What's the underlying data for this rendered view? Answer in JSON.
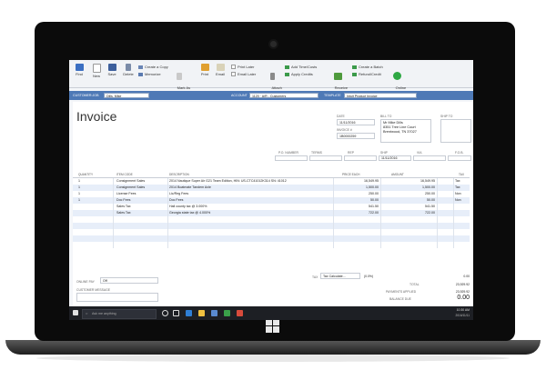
{
  "toolbar": {
    "find": "Find",
    "new": "New",
    "save": "Save",
    "delete": "Delete",
    "create_copy": "Create a Copy",
    "memorize": "Memorize",
    "mark_pending": "Mark As\nPending",
    "print": "Print",
    "email": "Email",
    "print_later": "Print Later",
    "email_later": "Email Later",
    "attach_file": "Attach\nFile",
    "add_time_costs": "Add Time/Costs",
    "apply_credits": "Apply Credits",
    "receive_payments": "Receive\nPayments",
    "create_batch": "Create a Batch",
    "refund_credit": "Refund/Credit",
    "online_pay": "Online\nPay"
  },
  "custbar": {
    "customer_job_label": "CUSTOMER:JOB",
    "customer_job_value": "Dills, Mike",
    "account_label": "ACCOUNT",
    "account_value": "1120 · A/R - Customers",
    "template_label": "TEMPLATE",
    "template_value": "Intuit Product Invoice"
  },
  "invoice": {
    "title": "Invoice",
    "date_label": "DATE",
    "date_value": "11/11/2016",
    "invoice_no_label": "INVOICE #",
    "invoice_no_value": "1B0000259",
    "bill_to_label": "BILL TO",
    "bill_to_lines": [
      "Mr Mike Dills",
      "8351 Tree Line Court",
      "Brentwood, TN 37027"
    ],
    "ship_to_label": "SHIP TO",
    "po_label": "P.O. NUMBER",
    "terms_label": "TERMS",
    "rep_label": "REP",
    "ship_label": "SHIP",
    "ship_value": "11/11/2016",
    "via_label": "VIA",
    "fob_label": "F.O.B."
  },
  "table": {
    "headers": [
      "QUANTITY",
      "ITEM CODE",
      "DESCRIPTION",
      "PRICE EACH",
      "AMOUNT",
      "TAX"
    ],
    "rows": [
      {
        "qty": "1",
        "item": "Consignment Sales",
        "desc": "2014 Nautique Super Air G21 Team Edition, HIN: US-CTC41012K314 SN: 41012",
        "price": "16,549.95",
        "amount": "16,549.95",
        "tax": "Tax"
      },
      {
        "qty": "1",
        "item": "Consignment Sales",
        "desc": "2014 Boatmate Tandem Axle",
        "price": "1,500.00",
        "amount": "1,500.00",
        "tax": "Tax"
      },
      {
        "qty": "1",
        "item": "License Fees",
        "desc": "Lic/Reg Fees",
        "price": "250.00",
        "amount": "250.00",
        "tax": "Non"
      },
      {
        "qty": "1",
        "item": "Doc Fees",
        "desc": "Doc Fees",
        "price": "50.00",
        "amount": "50.00",
        "tax": "Non"
      },
      {
        "qty": "",
        "item": "Sales Tax",
        "desc": "Hall county tax @ 3.000%",
        "price": "541.50",
        "amount": "541.50",
        "tax": ""
      },
      {
        "qty": "",
        "item": "Sales Tax",
        "desc": "Georgia state tax @ 4.000%",
        "price": "722.00",
        "amount": "722.00",
        "tax": ""
      },
      {
        "qty": "",
        "item": "",
        "desc": "",
        "price": "",
        "amount": "",
        "tax": ""
      },
      {
        "qty": "",
        "item": "",
        "desc": "",
        "price": "",
        "amount": "",
        "tax": ""
      },
      {
        "qty": "",
        "item": "",
        "desc": "",
        "price": "",
        "amount": "",
        "tax": ""
      },
      {
        "qty": "",
        "item": "",
        "desc": "",
        "price": "",
        "amount": "",
        "tax": ""
      },
      {
        "qty": "",
        "item": "",
        "desc": "",
        "price": "",
        "amount": "",
        "tax": ""
      }
    ]
  },
  "footer": {
    "online_pay_label": "ONLINE PAY",
    "online_pay_value": "Off",
    "customer_message_label": "CUSTOMER MESSAGE",
    "tax_label": "TAX",
    "tax_value": "Tax Calculate...",
    "tax_rate": "(0.0%)",
    "tax_amount": "0.00",
    "total_label": "TOTAL",
    "total_value": "23,929.92",
    "payments_label": "PAYMENTS APPLIED",
    "payments_value": "23,929.92",
    "balance_label": "BALANCE DUE",
    "balance_value": "0.00"
  },
  "taskbar": {
    "search_placeholder": "Ask me anything",
    "clock_time": "10:30 AM",
    "clock_date": "2016/11/11"
  },
  "colors": {
    "accent_blue": "#4e79b6",
    "row_alt": "#e7eef9",
    "taskbar": "#1d1f24",
    "bezel": "#0b0b0b"
  }
}
